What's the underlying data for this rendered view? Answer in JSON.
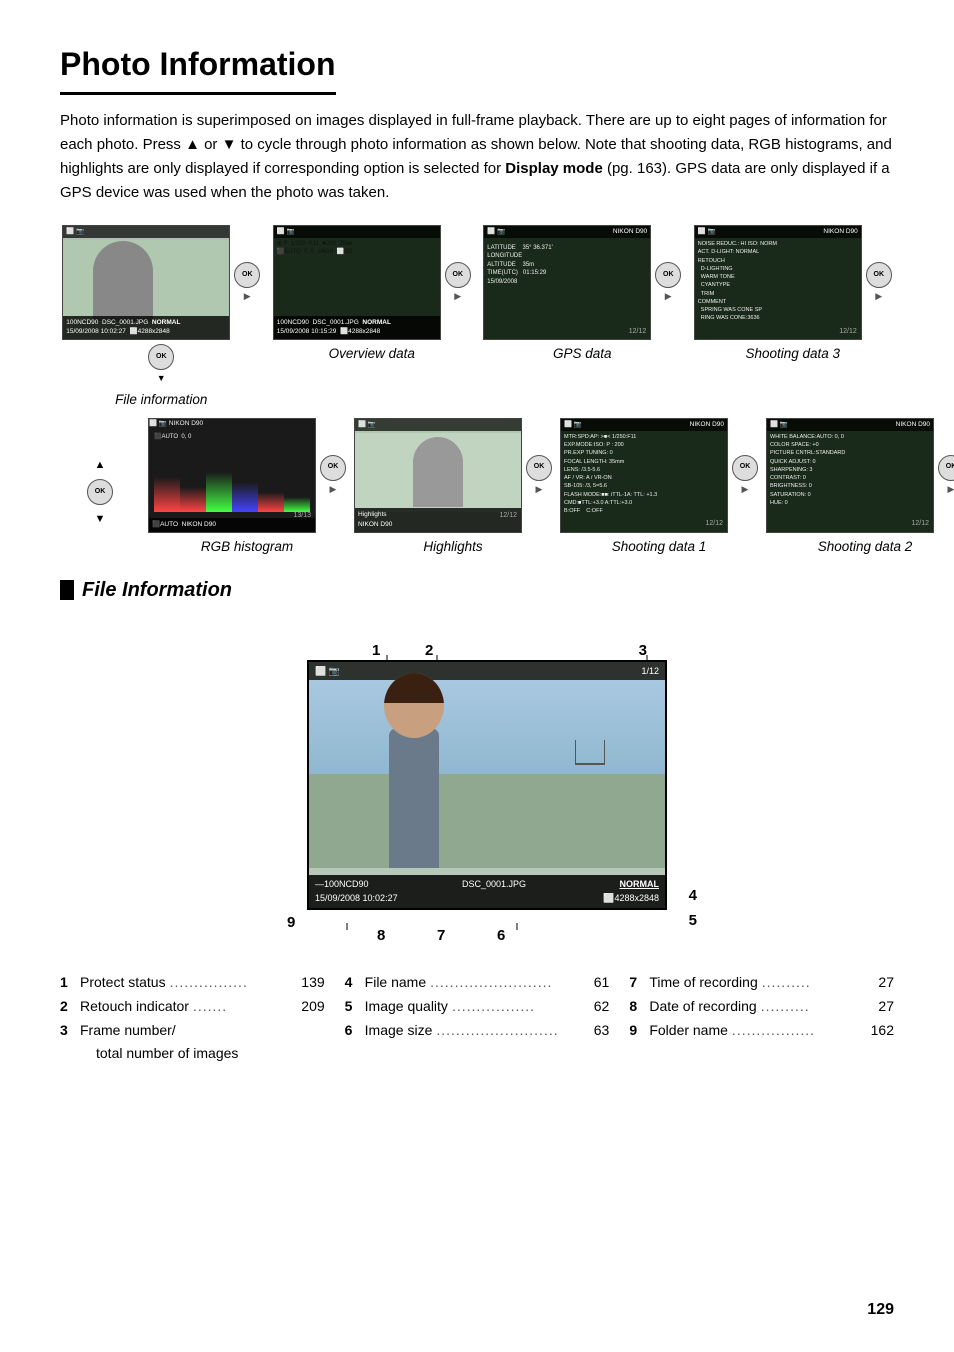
{
  "page": {
    "title": "Photo Information",
    "page_number": "129",
    "intro": "Photo information is superimposed on images displayed in full-frame playback. There are up to eight pages of information for each photo.  Press ▲ or ▼ to cycle through photo information as shown below.  Note that shooting data, RGB histograms, and highlights are only displayed if corresponding option is selected for ",
    "bold_text": "Display mode",
    "intro_cont": " (pg. 163).  GPS data are only displayed if a GPS device was used when the photo was taken."
  },
  "screenshots_row1": [
    {
      "label": "File information",
      "type": "file_info"
    },
    {
      "label": "Overview data",
      "type": "overview"
    },
    {
      "label": "GPS data",
      "type": "gps"
    },
    {
      "label": "Shooting data 3",
      "type": "shooting3"
    }
  ],
  "screenshots_row2": [
    {
      "label": "RGB histogram",
      "type": "histogram"
    },
    {
      "label": "Highlights",
      "type": "highlights"
    },
    {
      "label": "Shooting data 1",
      "type": "shooting1"
    },
    {
      "label": "Shooting data 2",
      "type": "shooting2"
    }
  ],
  "file_section": {
    "title": "File Information",
    "diagram_labels": {
      "1": "1",
      "2": "2",
      "3": "3",
      "4": "4",
      "5": "5",
      "6": "6",
      "7": "7",
      "8": "8",
      "9": "9"
    },
    "screen_data": {
      "folder": "100NCD90",
      "filename": "DSC_0001.JPG",
      "quality": "NORMAL",
      "date": "15/09/2008",
      "time": "10:02:27",
      "size": "⬜4288x2848",
      "frame": "1/12"
    }
  },
  "info_list": {
    "col1": [
      {
        "num": "1",
        "label": "Protect status",
        "dots": "................",
        "page": "139"
      },
      {
        "num": "2",
        "label": "Retouch indicator",
        "dots": ".......",
        "page": "209"
      },
      {
        "num": "3a",
        "label": "Frame number/",
        "sub": "     total number of images",
        "dots": "",
        "page": ""
      }
    ],
    "col2": [
      {
        "num": "4",
        "label": "File name",
        "dots": ".........................",
        "page": "61"
      },
      {
        "num": "5",
        "label": "Image quality",
        "dots": ".................",
        "page": "62"
      },
      {
        "num": "6",
        "label": "Image size",
        "dots": ".........................",
        "page": "63"
      }
    ],
    "col3": [
      {
        "num": "7",
        "label": "Time of recording",
        "dots": "..........",
        "page": "27"
      },
      {
        "num": "8",
        "label": "Date of recording",
        "dots": "..........",
        "page": "27"
      },
      {
        "num": "9",
        "label": "Folder name",
        "dots": ".................",
        "page": "162"
      }
    ]
  }
}
